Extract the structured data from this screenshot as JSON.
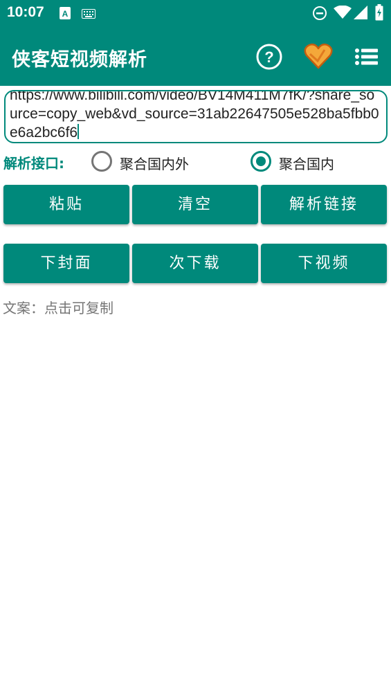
{
  "status_bar": {
    "time": "10:07",
    "icons": [
      "accessibility-a-icon",
      "keyboard-icon",
      "do-not-disturb-icon",
      "wifi-icon",
      "cell-signal-icon",
      "battery-icon"
    ]
  },
  "app_bar": {
    "title": "侠客短视频解析",
    "actions": [
      "help-icon",
      "heart-icon",
      "menu-list-icon"
    ]
  },
  "url_input": {
    "value": "https://www.bilibili.com/video/BV14M411M7fK/?share_source=copy_web&vd_source=31ab22647505e528ba5fbb0e6a2bc6f6"
  },
  "api": {
    "label": "解析接口:",
    "options": [
      {
        "label": "聚合国内外",
        "checked": false
      },
      {
        "label": "聚合国内",
        "checked": true
      }
    ]
  },
  "buttons_row1": [
    "粘贴",
    "清空",
    "解析链接"
  ],
  "buttons_row2": [
    "下封面",
    "次下载",
    "下视频"
  ],
  "copy_hint": "文案：点击可复制",
  "colors": {
    "primary": "#00897b",
    "heart": "#f4a83a",
    "text_secondary": "#757575"
  }
}
